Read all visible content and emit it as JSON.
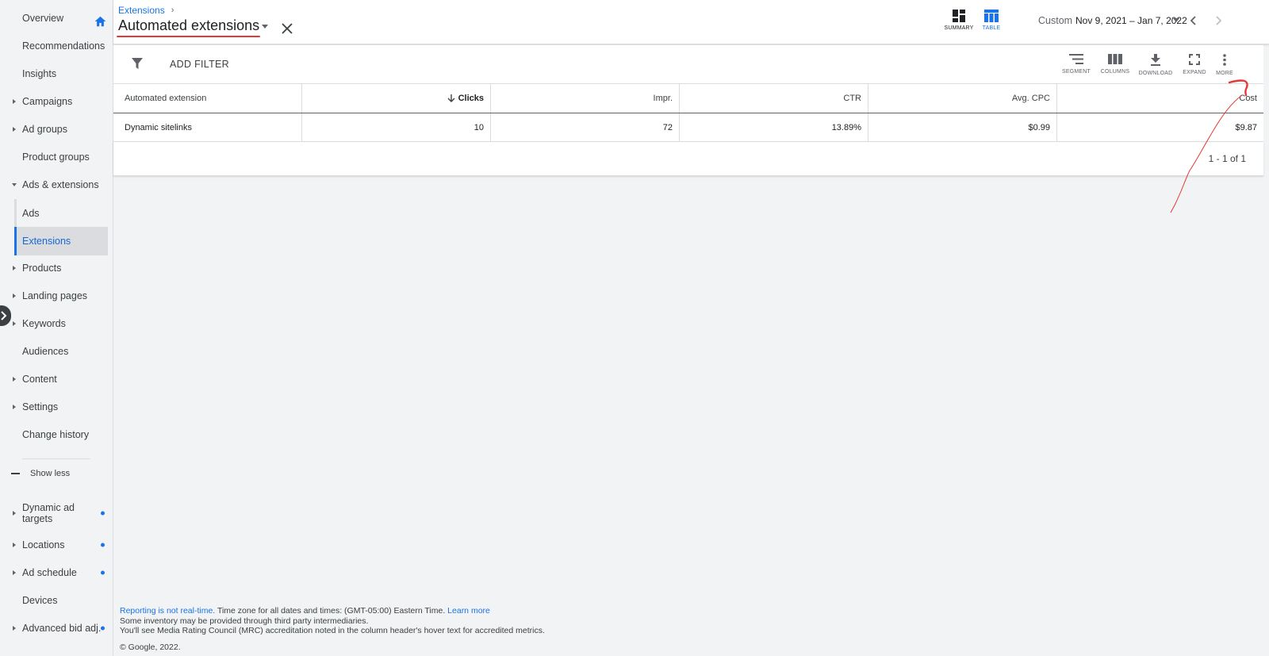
{
  "sidebar": {
    "items": [
      {
        "label": "Overview"
      },
      {
        "label": "Recommendations"
      },
      {
        "label": "Insights"
      },
      {
        "label": "Campaigns"
      },
      {
        "label": "Ad groups"
      },
      {
        "label": "Product groups"
      },
      {
        "label": "Ads & extensions"
      },
      {
        "label": "Ads"
      },
      {
        "label": "Extensions"
      },
      {
        "label": "Products"
      },
      {
        "label": "Landing pages"
      },
      {
        "label": "Keywords"
      },
      {
        "label": "Audiences"
      },
      {
        "label": "Content"
      },
      {
        "label": "Settings"
      },
      {
        "label": "Change history"
      },
      {
        "label": "Dynamic ad targets"
      },
      {
        "label": "Locations"
      },
      {
        "label": "Ad schedule"
      },
      {
        "label": "Devices"
      },
      {
        "label": "Advanced bid adj."
      }
    ],
    "show_less": "Show less",
    "active_item": "Extensions",
    "accent_color": "#1a73e8"
  },
  "header": {
    "breadcrumb": "Extensions",
    "title": "Automated extensions",
    "views": [
      {
        "label": "SUMMARY",
        "icon": "summary-dashboard-icon"
      },
      {
        "label": "TABLE",
        "icon": "table-icon",
        "selected": true
      }
    ],
    "date_range_label": "Custom",
    "date_range_value": "Nov 9, 2021 – Jan 7, 2022"
  },
  "toolbar": {
    "add_filter": "ADD FILTER",
    "tools": [
      {
        "label": "SEGMENT",
        "icon": "segment-icon"
      },
      {
        "label": "COLUMNS",
        "icon": "columns-icon"
      },
      {
        "label": "DOWNLOAD",
        "icon": "download-icon"
      },
      {
        "label": "EXPAND",
        "icon": "expand-icon"
      },
      {
        "label": "MORE",
        "icon": "more-vert-icon"
      }
    ]
  },
  "table": {
    "columns": [
      "Automated extension",
      "Clicks",
      "Impr.",
      "CTR",
      "Avg. CPC",
      "Cost"
    ],
    "sorted_column": "Clicks",
    "rows": [
      [
        "Dynamic sitelinks",
        "10",
        "72",
        "13.89%",
        "$0.99",
        "$9.87"
      ]
    ],
    "pagination": "1 - 1 of 1"
  },
  "footer": {
    "not_realtime": "Reporting is not real-time.",
    "timezone": " Time zone for all dates and times: (GMT-05:00) Eastern Time. ",
    "learn_more": "Learn more",
    "line2": "Some inventory may be provided through third party intermediaries.",
    "line3": "You'll see Media Rating Council (MRC) accreditation noted in the column header's hover text for accredited metrics.",
    "copyright": "© Google, 2022."
  },
  "annotation_color": "#e53935"
}
